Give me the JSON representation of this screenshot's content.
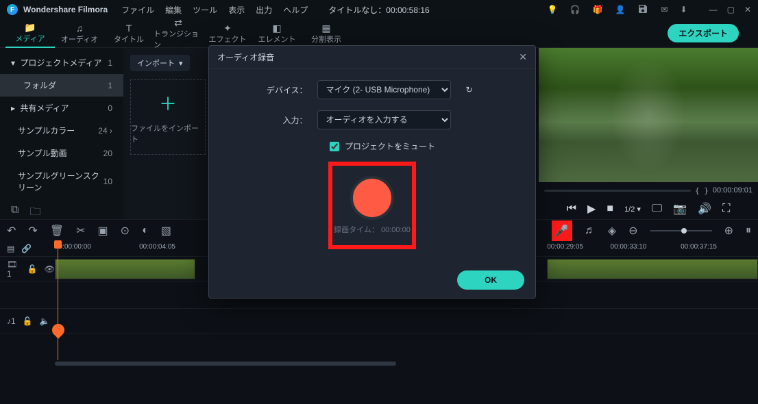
{
  "app": {
    "name": "Wondershare Filmora"
  },
  "menu": [
    "ファイル",
    "編集",
    "ツール",
    "表示",
    "出力",
    "ヘルプ"
  ],
  "title_center": "タイトルなし：00:00:58:16",
  "tabs": [
    {
      "label": "メディア"
    },
    {
      "label": "オーディオ"
    },
    {
      "label": "タイトル"
    },
    {
      "label": "トランジション"
    },
    {
      "label": "エフェクト"
    },
    {
      "label": "エレメント"
    },
    {
      "label": "分割表示"
    }
  ],
  "export_label": "エクスポート",
  "sidebar": {
    "items": [
      {
        "label": "プロジェクトメディア",
        "count": "1",
        "expandable": true
      },
      {
        "label": "フォルダ",
        "count": "1",
        "active": true
      },
      {
        "label": "共有メディア",
        "count": "0",
        "expandable": true
      },
      {
        "label": "サンプルカラー",
        "count": "24",
        "arrow_right": true
      },
      {
        "label": "サンプル動画",
        "count": "20"
      },
      {
        "label": "サンプルグリーンスクリーン",
        "count": "10"
      }
    ]
  },
  "import": {
    "button": "インポート",
    "box_label": "ファイルをインポート"
  },
  "preview": {
    "braces": "{     }",
    "timecode": "00:00:09:01",
    "speed": "1/2"
  },
  "timeline": {
    "ruler": [
      {
        "t": "00:00:00:00",
        "pos": 0
      },
      {
        "t": "00:00:04:05",
        "pos": 12
      },
      {
        "t": "00:00:29:05",
        "pos": 70
      },
      {
        "t": "00:00:33:10",
        "pos": 79
      },
      {
        "t": "00:00:37:15",
        "pos": 89
      }
    ]
  },
  "modal": {
    "title": "オーディオ録音",
    "device_label": "デバイス：",
    "device_value": "マイク (2- USB Microphone)",
    "input_label": "入力：",
    "input_value": "オーディオを入力する",
    "mute_label": "プロジェクトをミュート",
    "rec_time_label": "録画タイム：",
    "rec_time_value": "00:00:00",
    "ok": "OK"
  }
}
